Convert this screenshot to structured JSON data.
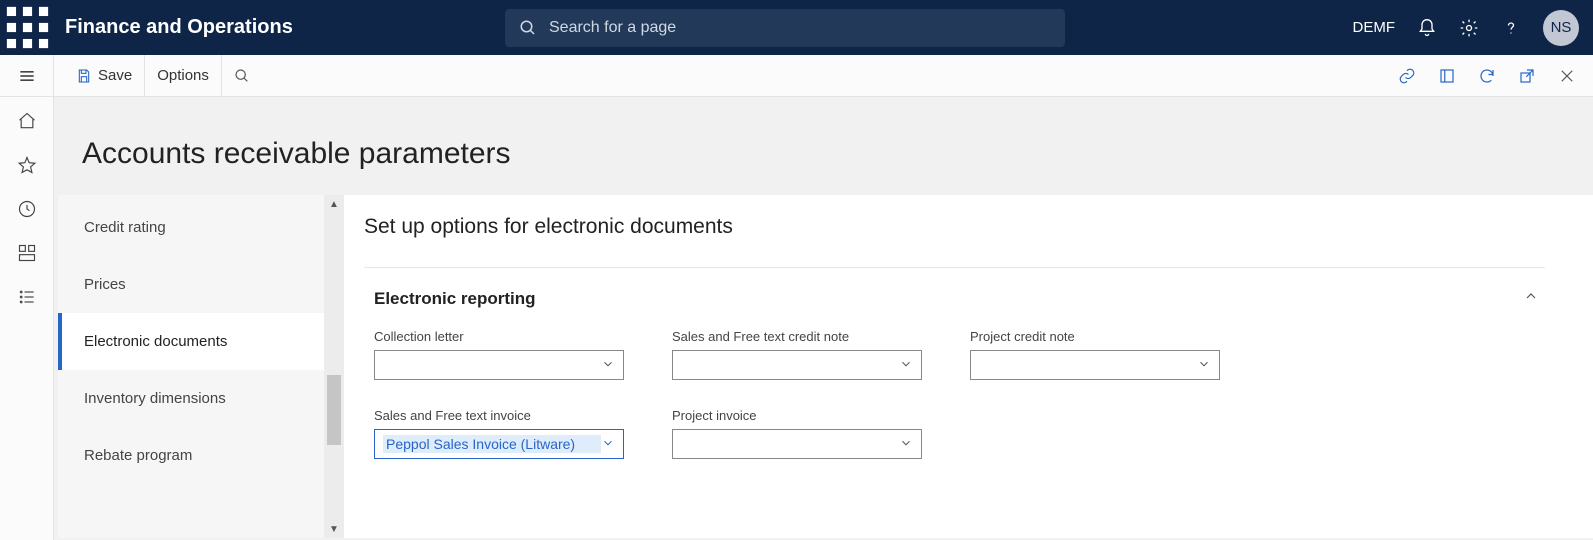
{
  "header": {
    "brand": "Finance and Operations",
    "search_placeholder": "Search for a page",
    "company": "DEMF",
    "avatar_initials": "NS"
  },
  "actionbar": {
    "save_label": "Save",
    "options_label": "Options"
  },
  "page": {
    "title": "Accounts receivable parameters"
  },
  "sidetabs": {
    "items": [
      {
        "label": "Credit rating"
      },
      {
        "label": "Prices"
      },
      {
        "label": "Electronic documents"
      },
      {
        "label": "Inventory dimensions"
      },
      {
        "label": "Rebate program"
      }
    ],
    "active_index": 2
  },
  "form": {
    "title": "Set up options for electronic documents",
    "section_label": "Electronic reporting",
    "fields": {
      "collection_letter": {
        "label": "Collection letter",
        "value": ""
      },
      "sales_free_text_credit_note": {
        "label": "Sales and Free text credit note",
        "value": ""
      },
      "project_credit_note": {
        "label": "Project credit note",
        "value": ""
      },
      "sales_free_text_invoice": {
        "label": "Sales and Free text invoice",
        "value": "Peppol Sales Invoice (Litware)"
      },
      "project_invoice": {
        "label": "Project invoice",
        "value": ""
      }
    }
  }
}
